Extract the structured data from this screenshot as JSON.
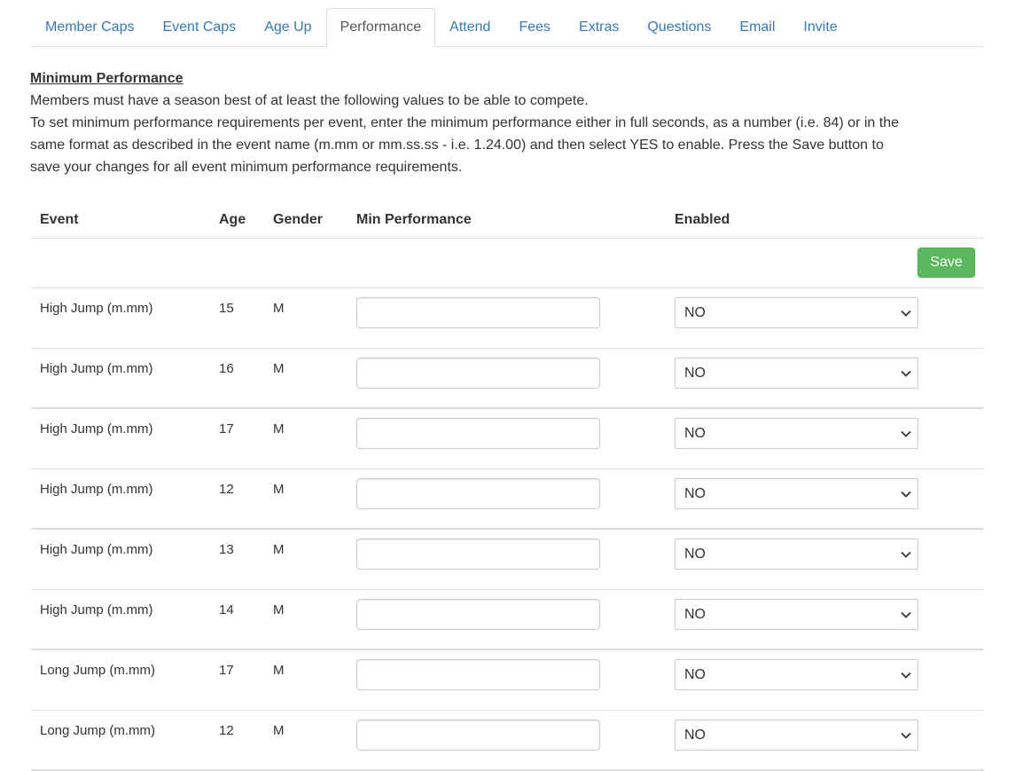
{
  "tabs": [
    {
      "label": "Member Caps"
    },
    {
      "label": "Event Caps"
    },
    {
      "label": "Age Up"
    },
    {
      "label": "Performance"
    },
    {
      "label": "Attend"
    },
    {
      "label": "Fees"
    },
    {
      "label": "Extras"
    },
    {
      "label": "Questions"
    },
    {
      "label": "Email"
    },
    {
      "label": "Invite"
    }
  ],
  "active_tab": "Performance",
  "intro": {
    "heading": "Minimum Performance",
    "line1": "Members must have a season best of at least the following values to be able to compete.",
    "line2": "To set minimum performance requirements per event, enter the minimum performance either in full seconds, as a number (i.e. 84) or in the same format as described in the event name (m.mm or mm.ss.ss - i.e. 1.24.00) and then select YES to enable. Press the Save button to save your changes for all event minimum performance requirements."
  },
  "table": {
    "headers": {
      "event": "Event",
      "age": "Age",
      "gender": "Gender",
      "min_performance": "Min Performance",
      "enabled": "Enabled"
    },
    "save_label": "Save",
    "rows": [
      {
        "event": "High Jump (m.mm)",
        "age": "15",
        "gender": "M",
        "min_performance": "",
        "enabled": "NO"
      },
      {
        "event": "High Jump (m.mm)",
        "age": "16",
        "gender": "M",
        "min_performance": "",
        "enabled": "NO"
      },
      {
        "event": "High Jump (m.mm)",
        "age": "17",
        "gender": "M",
        "min_performance": "",
        "enabled": "NO"
      },
      {
        "event": "High Jump (m.mm)",
        "age": "12",
        "gender": "M",
        "min_performance": "",
        "enabled": "NO"
      },
      {
        "event": "High Jump (m.mm)",
        "age": "13",
        "gender": "M",
        "min_performance": "",
        "enabled": "NO"
      },
      {
        "event": "High Jump (m.mm)",
        "age": "14",
        "gender": "M",
        "min_performance": "",
        "enabled": "NO"
      },
      {
        "event": "Long Jump (m.mm)",
        "age": "17",
        "gender": "M",
        "min_performance": "",
        "enabled": "NO"
      },
      {
        "event": "Long Jump (m.mm)",
        "age": "12",
        "gender": "M",
        "min_performance": "",
        "enabled": "NO"
      }
    ]
  },
  "colors": {
    "link": "#337ab7",
    "save_button": "#5cb85c",
    "border": "#dddddd"
  },
  "icons": {
    "select_arrow": "chevron-down-icon"
  }
}
